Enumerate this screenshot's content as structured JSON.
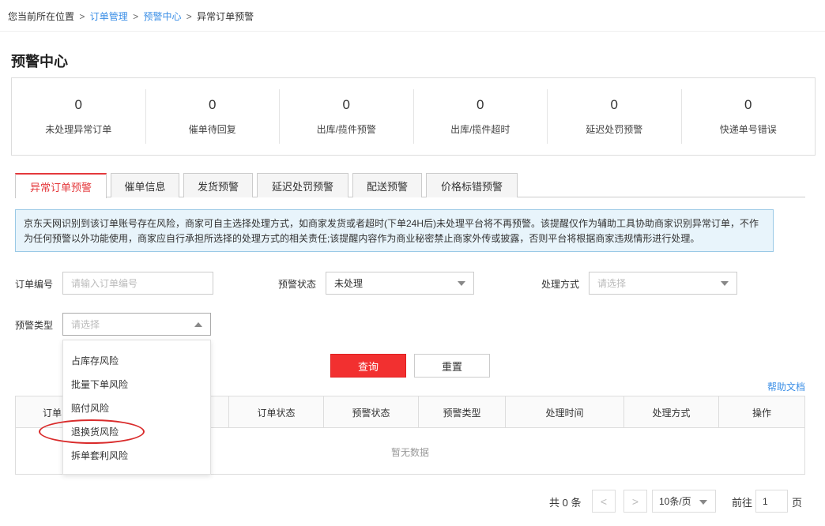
{
  "breadcrumb": {
    "prefix": "您当前所在位置",
    "sep": ">",
    "items": [
      "订单管理",
      "预警中心",
      "异常订单预警"
    ]
  },
  "page_title": "预警中心",
  "stats": [
    {
      "value": "0",
      "label": "未处理异常订单"
    },
    {
      "value": "0",
      "label": "催单待回复"
    },
    {
      "value": "0",
      "label": "出库/揽件预警"
    },
    {
      "value": "0",
      "label": "出库/揽件超时"
    },
    {
      "value": "0",
      "label": "延迟处罚预警"
    },
    {
      "value": "0",
      "label": "快递单号错误"
    }
  ],
  "tabs": [
    "异常订单预警",
    "催单信息",
    "发货预警",
    "延迟处罚预警",
    "配送预警",
    "价格标错预警"
  ],
  "notice": "京东天网识别到该订单账号存在风险，商家可自主选择处理方式，如商家发货或者超时(下单24H后)未处理平台将不再预警。该提醒仅作为辅助工具协助商家识别异常订单，不作为任何预警以外功能使用，商家应自行承担所选择的处理方式的相关责任;该提醒内容作为商业秘密禁止商家外传或披露，否则平台将根据商家违规情形进行处理。",
  "filters": {
    "order_no": {
      "label": "订单编号",
      "placeholder": "请输入订单编号"
    },
    "alert_status": {
      "label": "预警状态",
      "value": "未处理"
    },
    "handle_method": {
      "label": "处理方式",
      "placeholder": "请选择"
    },
    "alert_type": {
      "label": "预警类型",
      "placeholder": "请选择"
    }
  },
  "dropdown_options": [
    "占库存风险",
    "批量下单风险",
    "赔付风险",
    "退换货风险",
    "拆单套利风险"
  ],
  "buttons": {
    "query": "查询",
    "reset": "重置"
  },
  "help_link": "帮助文档",
  "table": {
    "columns": [
      "订单",
      "订单状态",
      "预警状态",
      "预警类型",
      "处理时间",
      "处理方式",
      "操作"
    ],
    "empty_text": "暂无数据"
  },
  "pagination": {
    "total": "共 0 条",
    "prev": "<",
    "next": ">",
    "page_size": "10条/页",
    "goto_label": "前往",
    "page": "1",
    "page_suffix": "页"
  },
  "colors": {
    "accent": "#e4393c",
    "link": "#3a8ee6",
    "highlight_circle": "#d92b2b"
  }
}
